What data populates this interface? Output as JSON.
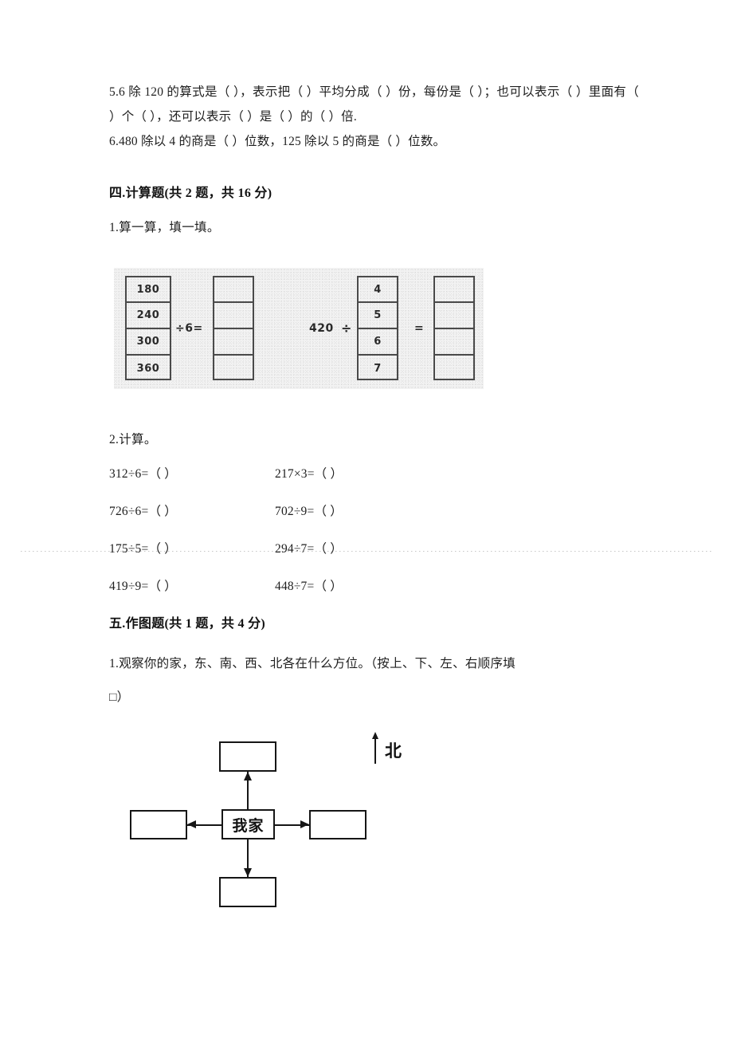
{
  "document": {
    "type": "math-worksheet",
    "grade_topic": "三年级除法练习"
  },
  "fill_in_blanks": {
    "item5": "5.6 除 120 的算式是（          ），表示把（          ）平均分成（          ）份，每份是（          ）；也可以表示（          ）里面有（          ）个（          ），还可以表示（          ）是（          ）的（          ）倍.",
    "item6": "6.480 除以 4 的商是（          ）位数，125 除以 5 的商是（          ）位数。"
  },
  "section4": {
    "heading": "四.计算题(共 2 题，共 16 分)",
    "q1_label": "1.算一算，填一填。",
    "q2_label": "2.计算。",
    "diagram": {
      "left_group": {
        "dividend_cells": [
          "180",
          "240",
          "300",
          "360"
        ],
        "operator": "÷6=",
        "answer_cells": [
          "",
          "",
          "",
          ""
        ]
      },
      "right_group": {
        "dividend": "420",
        "operator": "÷",
        "divisor_cells": [
          "4",
          "5",
          "6",
          "7"
        ],
        "equals": "=",
        "answer_cells": [
          "",
          "",
          "",
          ""
        ]
      }
    },
    "calculations": [
      [
        "312÷6=（          ）",
        "217×3=（          ）"
      ],
      [
        "726÷6=（          ）",
        "702÷9=（          ）"
      ],
      [
        "175÷5=（          ）",
        "294÷7=（          ）"
      ],
      [
        "419÷9=（          ）",
        "448÷7=（          ）"
      ]
    ]
  },
  "section5": {
    "heading": "五.作图题(共 1 题，共 4 分)",
    "q1_label": "1.观察你的家，东、南、西、北各在什么方位。（按上、下、左、右顺序填",
    "q1_label_cont": "□）",
    "diagram": {
      "center_label": "我家",
      "top_box": "",
      "bottom_box": "",
      "left_box": "",
      "right_box": "",
      "compass_label": "北"
    }
  },
  "colors": {
    "text": "#202020",
    "rule": "#4a4a4a",
    "panel_bg": "#f2f2f2",
    "diagram_stroke": "#161616"
  }
}
